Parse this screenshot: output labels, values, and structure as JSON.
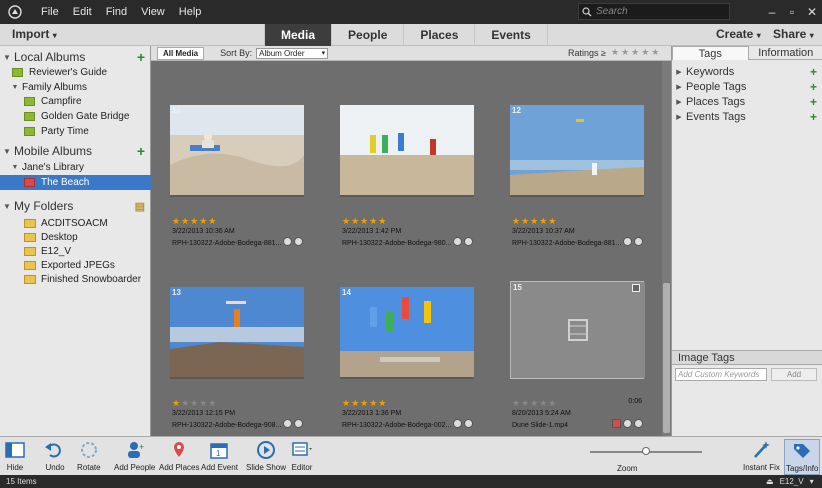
{
  "menubar": {
    "items": [
      "File",
      "Edit",
      "Find",
      "View",
      "Help"
    ],
    "search_placeholder": "Search",
    "window_controls": [
      "–",
      "▫",
      "✕"
    ]
  },
  "topbar": {
    "import_label": "Import",
    "tabs": [
      "Media",
      "People",
      "Places",
      "Events"
    ],
    "active_tab": "Media",
    "create_label": "Create",
    "share_label": "Share"
  },
  "left_panel": {
    "local_albums": "Local Albums",
    "reviewers_guide": "Reviewer's Guide",
    "family_albums": "Family Albums",
    "family_items": [
      "Campfire",
      "Golden Gate Bridge",
      "Party Time"
    ],
    "mobile_albums": "Mobile Albums",
    "janes_library": "Jane's Library",
    "the_beach": "The Beach",
    "my_folders": "My Folders",
    "folders": [
      "ACDITSOACM",
      "Desktop",
      "E12_V",
      "Exported JPEGs",
      "Finished Snowboarder"
    ]
  },
  "content": {
    "all_media": "All Media",
    "sort_by_label": "Sort By:",
    "sort_value": "Album Order",
    "ratings_label": "Ratings ≥",
    "ratings_stars": "★★★★★",
    "cards": [
      {
        "num": "10",
        "rating": 5,
        "date": "3/22/2013 10:36 AM",
        "file": "RPH-130322-Adobe-Bodega-881..."
      },
      {
        "num": "11",
        "rating": 5,
        "date": "3/22/2013 1:42 PM",
        "file": "RPH-130322-Adobe-Bodega-980..."
      },
      {
        "num": "12",
        "rating": 5,
        "date": "3/22/2013 10:37 AM",
        "file": "RPH-130322-Adobe-Bodega-881..."
      },
      {
        "num": "13",
        "rating": 1,
        "date": "3/22/2013 12:15 PM",
        "file": "RPH-130322-Adobe-Bodega-908..."
      },
      {
        "num": "14",
        "rating": 5,
        "date": "3/22/2013 1:36 PM",
        "file": "RPH-130322-Adobe-Bodega-002..."
      },
      {
        "num": "15",
        "rating": 0,
        "date": "8/20/2013 5:24 AM",
        "file": "Dune Slide-1.mp4",
        "duration": "0:06"
      }
    ]
  },
  "right_panel": {
    "tabs": [
      "Tags",
      "Information"
    ],
    "tag_groups": [
      "Keywords",
      "People Tags",
      "Places Tags",
      "Events Tags"
    ],
    "image_tags": "Image Tags",
    "custom_keywords_placeholder": "Add Custom Keywords",
    "add_label": "Add"
  },
  "toolbar": {
    "hide": "Hide",
    "undo": "Undo",
    "rotate": "Rotate",
    "add_people": "Add People",
    "add_places": "Add Places",
    "add_event": "Add Event",
    "slide_show": "Slide Show",
    "editor": "Editor",
    "zoom": "Zoom",
    "instant_fix": "Instant Fix",
    "tags_info": "Tags/Info"
  },
  "statusbar": {
    "count": "15 Items",
    "drive": "E12_V"
  },
  "colors": {
    "accent_blue": "#3c78c8",
    "star_gold": "#f0a000",
    "add_green": "#2c8a2c"
  }
}
